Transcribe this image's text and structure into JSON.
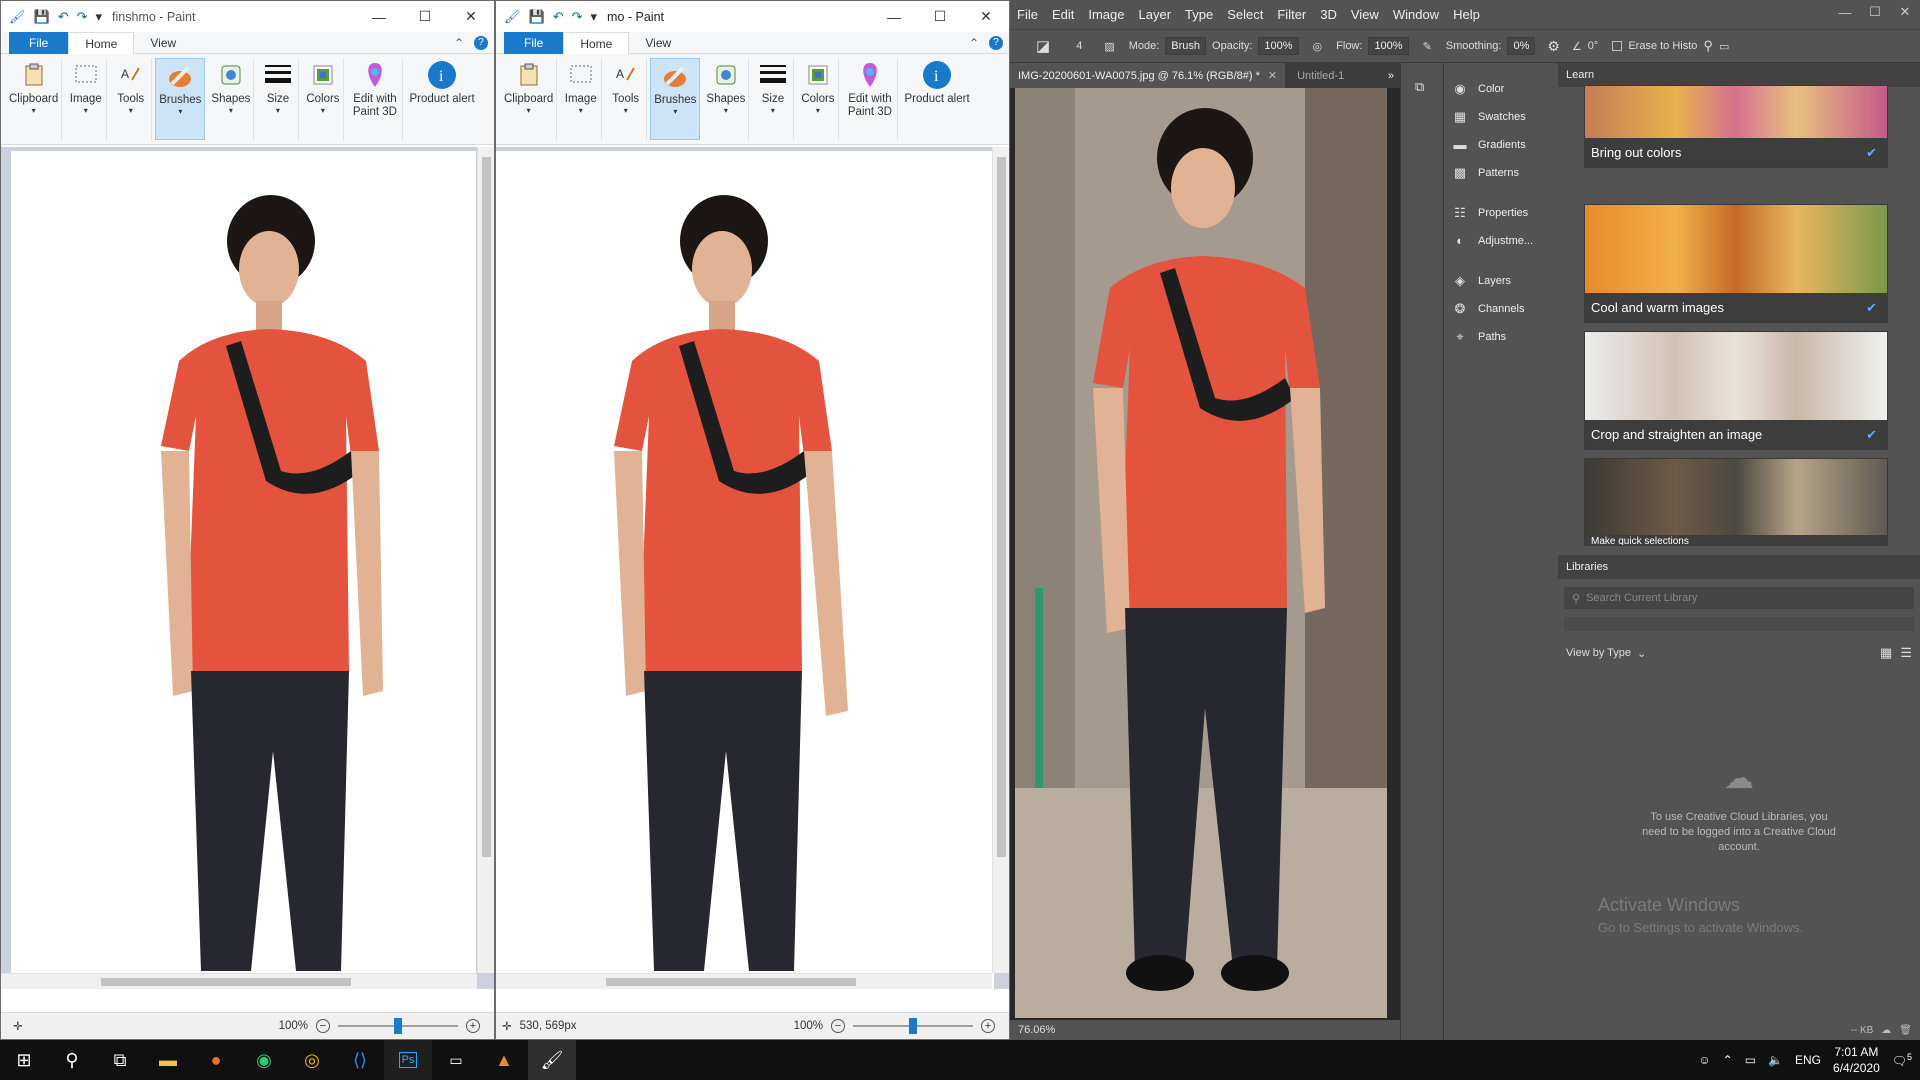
{
  "paint_left": {
    "title": "finshmo - Paint",
    "tabs": [
      "File",
      "Home",
      "View"
    ],
    "ribbon": [
      "Clipboard",
      "Image",
      "Tools",
      "Brushes",
      "Shapes",
      "Size",
      "Colors",
      "Edit with Paint 3D",
      "Product alert"
    ],
    "coords": "",
    "zoom": "100%"
  },
  "paint_right": {
    "title": "mo - Paint",
    "tabs": [
      "File",
      "Home",
      "View"
    ],
    "ribbon": [
      "Clipboard",
      "Image",
      "Tools",
      "Brushes",
      "Shapes",
      "Size",
      "Colors",
      "Edit with Paint 3D",
      "Product alert"
    ],
    "coords": "530, 569px",
    "zoom": "100%"
  },
  "photoshop": {
    "menu": [
      "File",
      "Edit",
      "Image",
      "Layer",
      "Type",
      "Select",
      "Filter",
      "3D",
      "View",
      "Window",
      "Help"
    ],
    "options": {
      "mode_label": "Mode:",
      "mode_value": "Brush",
      "opacity_label": "Opacity:",
      "opacity_value": "100%",
      "flow_label": "Flow:",
      "flow_value": "100%",
      "smoothing_label": "Smoothing:",
      "smoothing_value": "0%",
      "angle_value": "0°",
      "erase_label": "Erase to Histo",
      "brush_size": "4"
    },
    "doc_tab": "IMG-20200601-WA0075.jpg @ 76.1% (RGB/8#) *",
    "doc_tab2": "Untitled-1",
    "zoom_status": "76.06%",
    "panels": [
      "Color",
      "Swatches",
      "Gradients",
      "Patterns",
      "Properties",
      "Adjustme...",
      "Layers",
      "Channels",
      "Paths"
    ],
    "learn_title": "Learn",
    "learn_cards": [
      "Bring out colors",
      "Cool and warm images",
      "Crop and straighten an image",
      "Make quick selections"
    ],
    "libraries_title": "Libraries",
    "libraries_search": "Search Current Library",
    "view_by": "View by Type",
    "libraries_msg": "To use Creative Cloud Libraries, you need to be logged into a Creative Cloud account.",
    "libraries_size": "-- KB",
    "activate_title": "Activate Windows",
    "activate_sub": "Go to Settings to activate Windows."
  },
  "taskbar": {
    "lang": "ENG",
    "time": "7:01 AM",
    "date": "6/4/2020",
    "notif": "5"
  }
}
